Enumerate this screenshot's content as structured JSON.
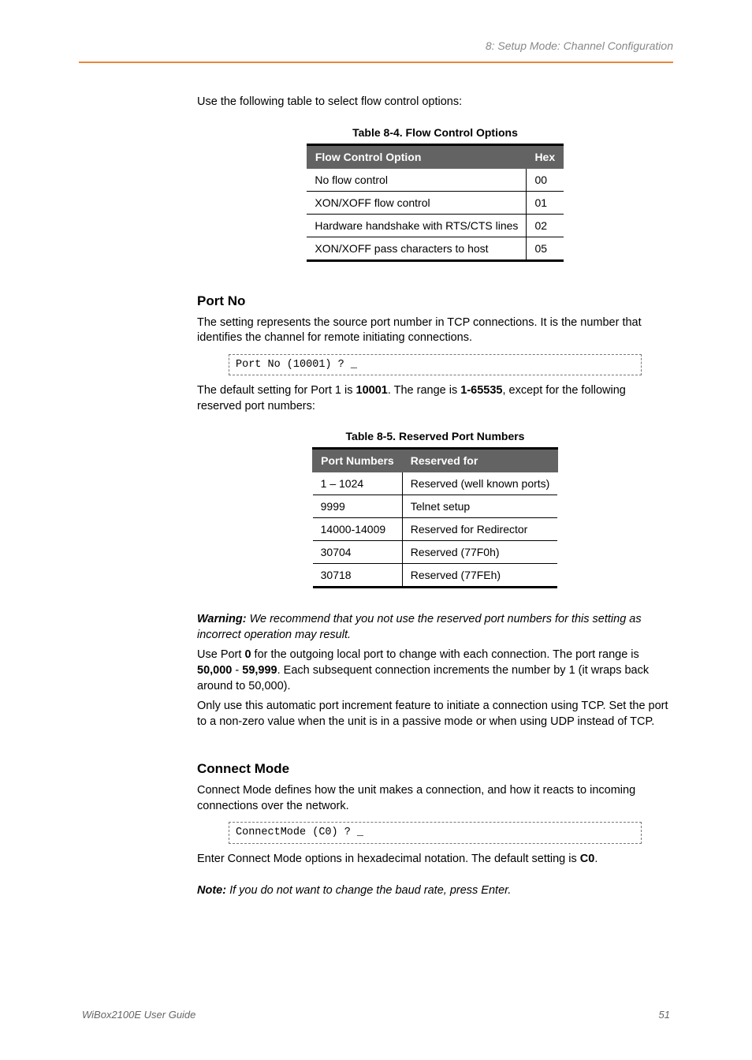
{
  "header": {
    "text": "8: Setup Mode: Channel Configuration"
  },
  "intro": "Use the following table to select flow control options:",
  "table1": {
    "caption": "Table 8-4.  Flow Control Options",
    "headers": [
      "Flow Control Option",
      "Hex"
    ],
    "rows": [
      [
        "No flow control",
        "00"
      ],
      [
        "XON/XOFF flow control",
        "01"
      ],
      [
        "Hardware handshake with RTS/CTS lines",
        "02"
      ],
      [
        "XON/XOFF pass characters to host",
        "05"
      ]
    ]
  },
  "port_no": {
    "title": "Port No",
    "p1": "The setting represents the source port number in TCP connections. It is the number that identifies the channel for remote initiating connections.",
    "code": "Port No (10001) ? _",
    "p2a": "The default setting for Port 1 is ",
    "p2b": "10001",
    "p2c": ". The range is ",
    "p2d": "1-65535",
    "p2e": ", except for the following reserved port numbers:"
  },
  "table2": {
    "caption": "Table 8-5.  Reserved Port Numbers",
    "headers": [
      "Port Numbers",
      "Reserved for"
    ],
    "rows": [
      [
        "1 – 1024",
        "Reserved (well known ports)"
      ],
      [
        "9999",
        "Telnet setup"
      ],
      [
        "14000-14009",
        "Reserved for Redirector"
      ],
      [
        "30704",
        "Reserved (77F0h)"
      ],
      [
        "30718",
        "Reserved (77FEh)"
      ]
    ]
  },
  "warning": {
    "label": "Warning:",
    "text": " We recommend that you not use the reserved port numbers for this setting as incorrect operation may result."
  },
  "useport": {
    "a": "Use Port ",
    "b": "0",
    "c": " for the outgoing local port to change with each connection. The port range is ",
    "d": "50,000",
    "e": " - ",
    "f": "59,999",
    "g": ". Each subsequent connection increments the number by 1 (it wraps back around to 50,000)."
  },
  "only": "Only use this automatic port increment feature to initiate a connection using TCP. Set the port to a non-zero value when the unit is in a passive mode or when using UDP instead of TCP.",
  "connect_mode": {
    "title": "Connect Mode",
    "p1": "Connect Mode defines how the unit makes a connection, and how it reacts to incoming connections over the network.",
    "code": "ConnectMode (C0) ? _",
    "p2a": "Enter Connect Mode options in hexadecimal notation. The default setting is ",
    "p2b": "C0",
    "p2c": "."
  },
  "note": {
    "label": "Note:",
    "text": " If you do not want to change the baud rate, press Enter."
  },
  "footer": {
    "left": "WiBox2100E  User Guide",
    "right": "51"
  }
}
